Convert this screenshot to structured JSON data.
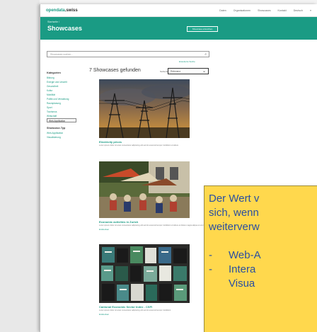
{
  "header": {
    "logo_pre": "opendata",
    "logo_post": ".swiss",
    "nav": [
      "Daten",
      "Organisationen",
      "Showcases",
      "Kontakt",
      "Deutsch",
      "≡"
    ]
  },
  "hero": {
    "breadcrumb": "Startseite /",
    "title": "Showcases",
    "button_label": "Showcase einreichen"
  },
  "search": {
    "placeholder": "Showcases suchen...",
    "advanced_link": "Erweiterte Suche"
  },
  "sidebar": {
    "group1_title": "Kategorien",
    "group1_items": [
      "Bildung",
      "Energie und Umwelt",
      "Gesundheit",
      "Kultur",
      "Mobilität",
      "Politik und Verwaltung",
      "Raumplanung",
      "Sport",
      "Tourismus",
      "Wirtschaft",
      "Web-Applikation"
    ],
    "group2_title": "Showcase-Typ",
    "group2_items": [
      "Web-Applikation",
      "Visualisierung"
    ]
  },
  "results": {
    "count_label": "7 Showcases gefunden",
    "sort_label": "Sortieren nach",
    "sort_value": "Relevanz"
  },
  "cards": [
    {
      "title": "Electricity prices",
      "description": "Lorem ipsum dolor sit amet consectetur adipiscing elit sed do eiusmod tempor incididunt ut labore",
      "link": ""
    },
    {
      "title": "Economic activities in Zurich",
      "description": "Lorem ipsum dolor sit amet consectetur adipiscing elit sed do eiusmod tempor incididunt ut labore et dolore magna aliqua ut enim ad minim veniam",
      "link": "Entdecken"
    },
    {
      "title": "Cantonal Economic Sector Index - CSFI",
      "description": "Lorem ipsum dolor sit amet consectetur adipiscing elit sed do eiusmod tempor incididunt",
      "link": "Entdecken"
    }
  ],
  "callout": {
    "lines": [
      "Der Wert v",
      "sich, wenn",
      "weiterverw"
    ],
    "bullets": [
      "Web-A",
      "Intera",
      "Visua"
    ]
  }
}
